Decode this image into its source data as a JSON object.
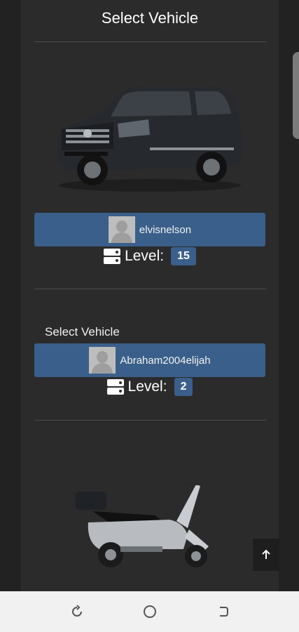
{
  "header": {
    "title": "Select Vehicle"
  },
  "vehicles": [
    {
      "type": "car",
      "owner": "elvisnelson",
      "level_label": "Level:",
      "level": "15"
    },
    {
      "section_label": "Select Vehicle",
      "owner": "Abraham2004elijah",
      "level_label": "Level:",
      "level": "2"
    },
    {
      "type": "scooter"
    }
  ],
  "controls": {
    "scroll_top_icon": "arrow-up-icon"
  },
  "nav_bar": {
    "icons": [
      "recent-apps-icon",
      "home-icon",
      "back-icon"
    ]
  },
  "colors": {
    "panel": "#2b2b2b",
    "accent": "#3a5f8a"
  }
}
